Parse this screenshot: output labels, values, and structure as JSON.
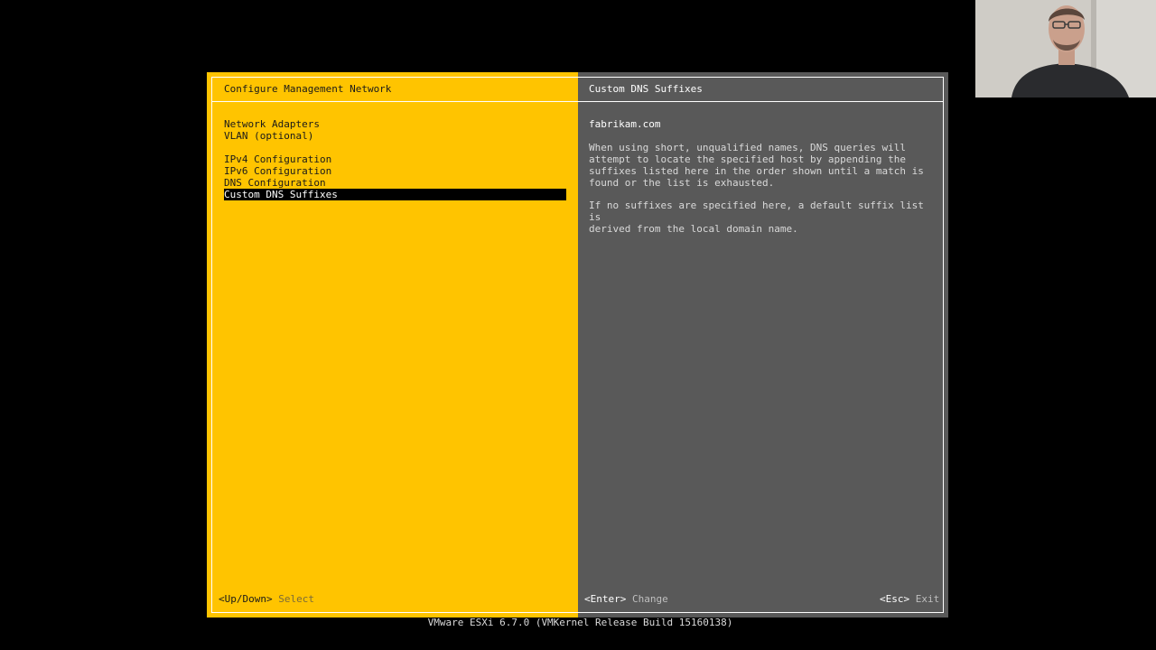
{
  "left_panel": {
    "title": "Configure Management Network",
    "menu_items": [
      {
        "label": "Network Adapters",
        "selected": false
      },
      {
        "label": "VLAN (optional)",
        "selected": false
      },
      {
        "label": "IPv4 Configuration",
        "selected": false
      },
      {
        "label": "IPv6 Configuration",
        "selected": false
      },
      {
        "label": "DNS Configuration",
        "selected": false
      },
      {
        "label": "Custom DNS Suffixes",
        "selected": true
      }
    ]
  },
  "right_panel": {
    "title": "Custom DNS Suffixes",
    "value": "fabrikam.com",
    "description_1": "When using short, unqualified names, DNS queries will\nattempt to locate the specified host by appending the\nsuffixes listed here in the order shown until a match is\nfound or the list is exhausted.",
    "description_2": "If no suffixes are specified here, a default suffix list is\nderived from the local domain name."
  },
  "footer": {
    "select_key": "<Up/Down>",
    "select_action": "Select",
    "change_key": "<Enter>",
    "change_action": "Change",
    "exit_key": "<Esc>",
    "exit_action": "Exit"
  },
  "build_info": "VMware ESXi 6.7.0 (VMKernel Release Build 15160138)",
  "colors": {
    "accent_yellow": "#ffc400",
    "panel_gray": "#595959",
    "background": "#000000",
    "selection": "#000000"
  }
}
